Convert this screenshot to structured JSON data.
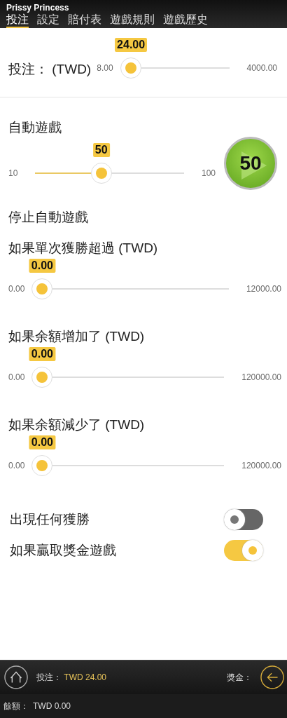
{
  "app_title": "Prissy Princess",
  "tabs": [
    {
      "label": "投注",
      "selected": true
    },
    {
      "label": "設定",
      "selected": false
    },
    {
      "label": "賠付表",
      "selected": false
    },
    {
      "label": "遊戲規則",
      "selected": false
    },
    {
      "label": "遊戲歷史",
      "selected": false
    }
  ],
  "bet": {
    "label": "投注： (TWD)",
    "min": "8.00",
    "max": "4000.00",
    "value": "24.00",
    "level": 0.004
  },
  "autoplay": {
    "title": "自動遊戲",
    "min": "10",
    "max": "100",
    "value": "50",
    "level": 0.444,
    "button_label": "50"
  },
  "stop_title": "停止自動遊戲",
  "limits": [
    {
      "label": "如果單次獲勝超過 (TWD)",
      "min": "0.00",
      "max": "12000.00",
      "value": "0.00",
      "level": 0
    },
    {
      "label": "如果余額增加了 (TWD)",
      "min": "0.00",
      "max": "120000.00",
      "value": "0.00",
      "level": 0
    },
    {
      "label": "如果余額減少了 (TWD)",
      "min": "0.00",
      "max": "120000.00",
      "value": "0.00",
      "level": 0
    }
  ],
  "toggles": [
    {
      "label": "出現任何獲勝",
      "on": false
    },
    {
      "label": "如果贏取獎金遊戲",
      "on": true
    }
  ],
  "footer": {
    "bet_label": "投注：",
    "bet_value": "TWD 24.00",
    "win_label": "獎金：",
    "balance_label": "餘額：",
    "balance_value": "TWD 0.00"
  }
}
